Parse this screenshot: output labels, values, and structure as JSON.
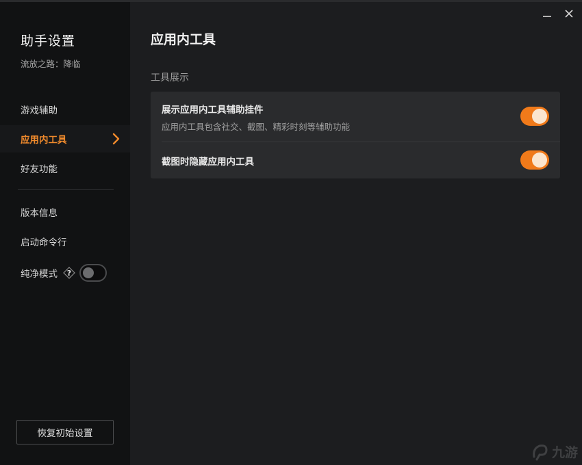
{
  "sidebar": {
    "title": "助手设置",
    "subtitle": "流放之路：降临",
    "items": [
      {
        "label": "游戏辅助",
        "active": false
      },
      {
        "label": "应用内工具",
        "active": true
      },
      {
        "label": "好友功能",
        "active": false
      },
      {
        "label": "版本信息",
        "active": false
      },
      {
        "label": "启动命令行",
        "active": false
      }
    ],
    "pure_mode": {
      "label": "纯净模式",
      "help_icon": "question-icon",
      "enabled": false
    },
    "reset_label": "恢复初始设置"
  },
  "main": {
    "title": "应用内工具",
    "section_label": "工具展示",
    "settings": [
      {
        "label": "展示应用内工具辅助挂件",
        "desc": "应用内工具包含社交、截图、精彩时刻等辅助功能",
        "enabled": true
      },
      {
        "label": "截图时隐藏应用内工具",
        "enabled": true
      }
    ]
  },
  "window_controls": {
    "minimize_icon": "minimize-icon",
    "close_icon": "close-icon"
  },
  "watermark": {
    "text": "九游"
  },
  "colors": {
    "accent": "#f07a1a",
    "active_text": "#f08a2c",
    "sidebar_bg": "#111213",
    "main_bg": "#1c1d1f",
    "card_bg": "#2a2b2d"
  }
}
